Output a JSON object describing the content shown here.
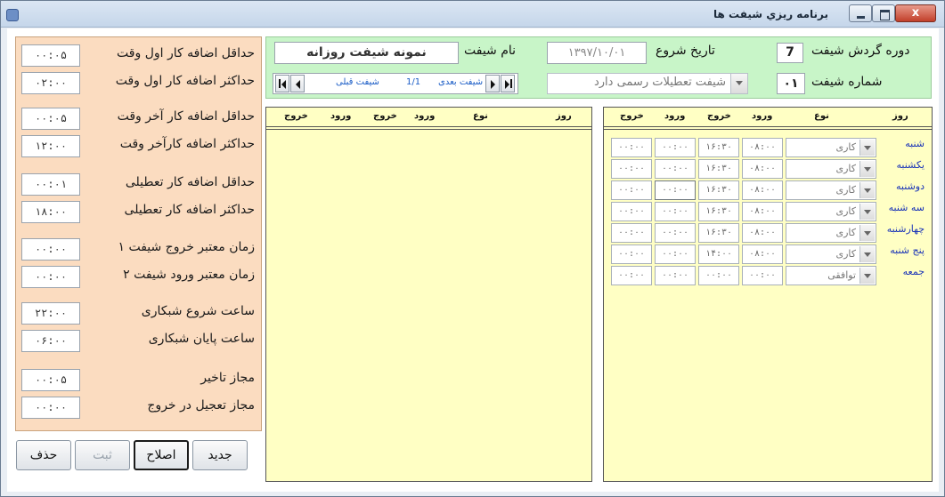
{
  "window": {
    "title": "برنامه ریزي شيفت ها",
    "close_label": "x"
  },
  "settings": [
    {
      "value": "۰۰:۰۵",
      "label": "حداقل اضافه کار اول وقت"
    },
    {
      "value": "۰۲:۰۰",
      "label": "حداکثر اضافه کار اول وقت"
    },
    {
      "value": "۰۰:۰۵",
      "label": "حداقل اضافه کار آخر وقت"
    },
    {
      "value": "۱۲:۰۰",
      "label": "حداکثر اضافه کارآخر وقت"
    },
    {
      "value": "۰۰:۰۱",
      "label": "حداقل اضافه کار تعطیلی"
    },
    {
      "value": "۱۸:۰۰",
      "label": "حداکثر اضافه کار تعطیلی"
    },
    {
      "value": "۰۰:۰۰",
      "label": "زمان معتبر خروج شیفت ۱"
    },
    {
      "value": "۰۰:۰۰",
      "label": "زمان معتبر ورود شیفت ۲"
    },
    {
      "value": "۲۲:۰۰",
      "label": "ساعت شروع شبکاری"
    },
    {
      "value": "۰۶:۰۰",
      "label": "ساعت پایان شبکاری"
    },
    {
      "value": "۰۰:۰۵",
      "label": "مجاز تاخیر"
    },
    {
      "value": "۰۰:۰۰",
      "label": "مجاز تعجیل در خروج"
    }
  ],
  "buttons": {
    "new": "جدید",
    "edit": "اصلاح",
    "save": "ثبت",
    "delete": "حذف"
  },
  "header": {
    "cycle_label": "دوره گردش شیفت",
    "cycle_value": "7",
    "shift_number_label": "شماره شیفت",
    "shift_number_value": "۰۱",
    "start_date_label": "تاریخ شروع",
    "start_date_value": "۱۳۹۷/۱۰/۰۱",
    "shift_name_label": "نام شیفت",
    "shift_name_value": "نمونه شيفت روزانه",
    "holiday_combo": "شيفت تعطيلات رسمی دارد"
  },
  "navigator": {
    "next": "شیفت بعدی",
    "position": "1/1",
    "prev": "شیفت قبلی"
  },
  "table_headers": {
    "day": "روز",
    "type": "نوع",
    "in": "ورود",
    "out": "خروج"
  },
  "schedule": [
    {
      "day": "شنبه",
      "type": "کاری",
      "in1": "۰۸:۰۰",
      "out1": "۱۶:۳۰",
      "in2": "۰۰:۰۰",
      "out2": "۰۰:۰۰"
    },
    {
      "day": "یکشنبه",
      "type": "کاری",
      "in1": "۰۸:۰۰",
      "out1": "۱۶:۳۰",
      "in2": "۰۰:۰۰",
      "out2": "۰۰:۰۰"
    },
    {
      "day": "دوشنبه",
      "type": "کاری",
      "in1": "۰۸:۰۰",
      "out1": "۱۶:۳۰",
      "in2": "۰۰:۰۰",
      "out2": "۰۰:۰۰"
    },
    {
      "day": "سه شنبه",
      "type": "کاری",
      "in1": "۰۸:۰۰",
      "out1": "۱۶:۳۰",
      "in2": "۰۰:۰۰",
      "out2": "۰۰:۰۰"
    },
    {
      "day": "چهارشنبه",
      "type": "کاری",
      "in1": "۰۸:۰۰",
      "out1": "۱۶:۳۰",
      "in2": "۰۰:۰۰",
      "out2": "۰۰:۰۰"
    },
    {
      "day": "پنج شنبه",
      "type": "کاری",
      "in1": "۰۸:۰۰",
      "out1": "۱۴:۰۰",
      "in2": "۰۰:۰۰",
      "out2": "۰۰:۰۰"
    },
    {
      "day": "جمعه",
      "type": "توافقی",
      "in1": "۰۰:۰۰",
      "out1": "۰۰:۰۰",
      "in2": "۰۰:۰۰",
      "out2": "۰۰:۰۰"
    }
  ]
}
